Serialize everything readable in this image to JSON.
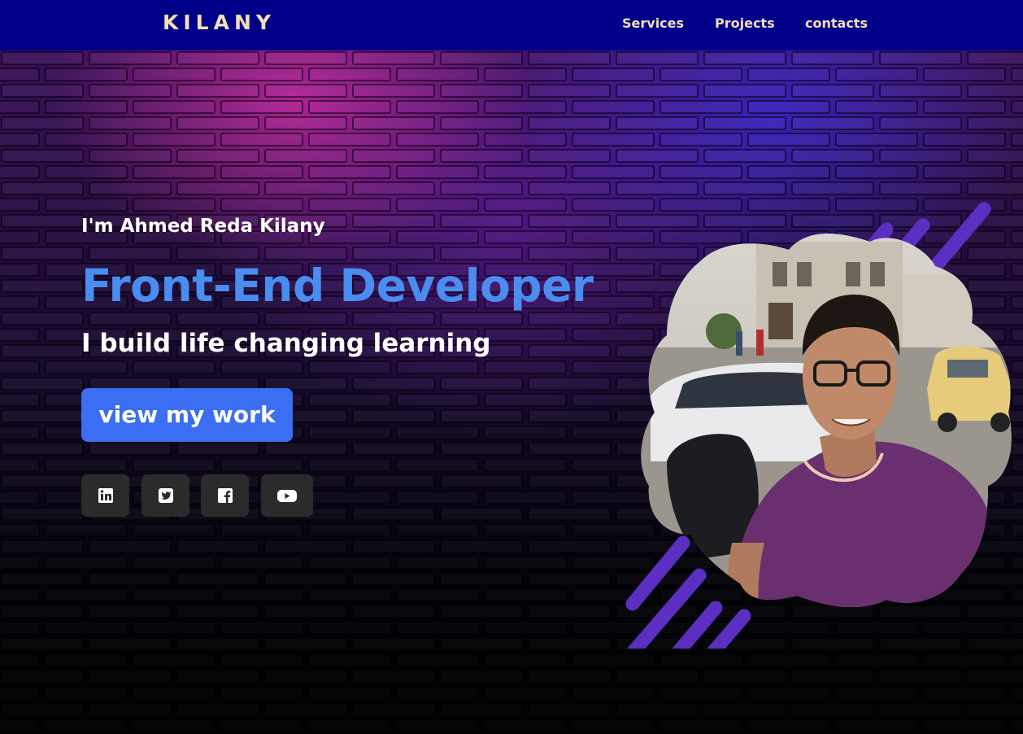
{
  "navbar": {
    "logo": "KILANY",
    "links": [
      {
        "label": "Services"
      },
      {
        "label": "Projects"
      },
      {
        "label": "contacts"
      }
    ]
  },
  "hero": {
    "greeting": "I'm Ahmed Reda Kilany",
    "headline": "Front-End Developer",
    "tagline": "I build life changing learning",
    "cta_label": "view my work",
    "social_icons": [
      "linkedin-icon",
      "twitter-icon",
      "facebook-icon",
      "youtube-icon"
    ]
  },
  "colors": {
    "navbar_bg": "#00008b",
    "logo": "#f5deb3",
    "headline": "#4a8cf0",
    "cta_bg": "#3b6ef2",
    "social_bg": "#2b2b2b",
    "accent_stripes": "#5b2fc2"
  }
}
